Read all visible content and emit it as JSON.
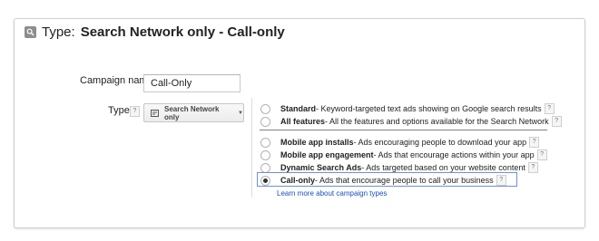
{
  "header": {
    "title_prefix": "Type:",
    "title_value": "Search Network only - Call-only",
    "icon": "search-icon"
  },
  "form": {
    "campaign_name_label": "Campaign name",
    "campaign_name_value": "Call-Only",
    "type_label": "Type",
    "help_glyph": "?",
    "type_dropdown": {
      "selected": "Search Network only",
      "icon": "search-network-icon",
      "arrow_icon": "chevron-down-icon"
    }
  },
  "options": {
    "group1": [
      {
        "title": "Standard",
        "desc": " - Keyword-targeted text ads showing on Google search results",
        "checked": false
      },
      {
        "title": "All features",
        "desc": " - All the features and options available for the Search Network",
        "checked": false
      }
    ],
    "group2": [
      {
        "title": "Mobile app installs",
        "desc": " - Ads encouraging people to download your app",
        "checked": false
      },
      {
        "title": "Mobile app engagement",
        "desc": " - Ads that encourage actions within your app",
        "checked": false
      },
      {
        "title": "Dynamic Search Ads",
        "desc": " - Ads targeted based on your website content",
        "checked": false
      },
      {
        "title": "Call-only",
        "desc": " - Ads that encourage people to call your business",
        "checked": true
      }
    ],
    "learn_more": "Learn more about campaign types"
  },
  "colors": {
    "link": "#1a4fbf",
    "highlight_border": "#6f8fd8"
  }
}
